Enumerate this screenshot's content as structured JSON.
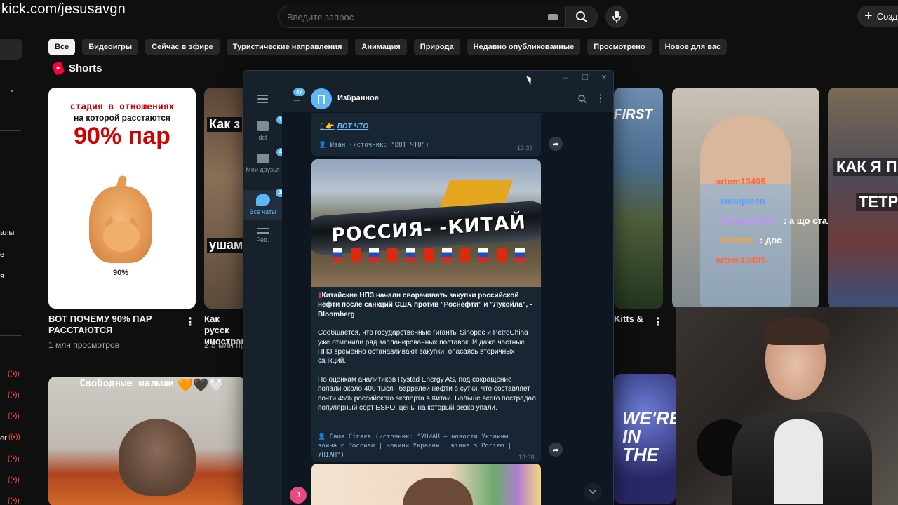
{
  "watermark": "kick.com/jesusavgn",
  "youtube": {
    "search_placeholder": "Введите запрос",
    "create_label": "Созд",
    "chips": [
      "Все",
      "Видеоигры",
      "Сейчас в эфире",
      "Туристические направления",
      "Анимация",
      "Природа",
      "Недавно опубликованные",
      "Просмотрено",
      "Новое для вас"
    ],
    "shorts_label": "Shorts",
    "sidebar_fragments": [
      "алы",
      "е",
      "я",
      "er"
    ],
    "cards": [
      {
        "overlay_line1": "стадия в отношениях",
        "overlay_line2": "на которой расстаются",
        "overlay_big": "90% пар",
        "overlay_small": "90%",
        "title": "ВОТ ПОЧЕМУ 90% ПАР РАССТАЮТСЯ",
        "meta": "1 млн просмотров"
      },
      {
        "overlay_a": "Как з",
        "overlay_b": "ушам",
        "title": "Как русск иностран",
        "meta": "2,5 млн пр"
      },
      {
        "overlay": "FIRST",
        "title": "Kitts &"
      },
      {
        "chat": [
          {
            "name": "artem13495",
            "msg": ""
          },
          {
            "name": "emoqueen",
            "msg": ""
          },
          {
            "name": "Yaroslav753",
            "msg": ": а що сталося"
          },
          {
            "name": "Akihara",
            "msg": ": дос"
          },
          {
            "name": "artem13495",
            "msg": ""
          }
        ]
      },
      {
        "overlay": "КАК Я П",
        "overlay2": "ТЕТР"
      },
      {
        "overlay": "Свободные малыши",
        "hearts": "🧡🖤🤍"
      },
      {
        "overlay": "WE'RE IN THE"
      }
    ]
  },
  "telegram": {
    "back_count": "47",
    "folders": [
      {
        "name": "dct",
        "count": "188"
      },
      {
        "name": "Мои друзья",
        "count": "44"
      },
      {
        "name": "Все чаты",
        "count": "407"
      },
      {
        "name": "Ред."
      }
    ],
    "chat_title": "Избранное",
    "messages": [
      {
        "link_text": "ВОТ ЧТО",
        "fwd": "👤 Иван (источник: \"ВОТ ЧТО\")",
        "time": "13:36"
      },
      {
        "image_text": "РОССИЯ-  -КИТАЙ",
        "headline": "Китайские НПЗ начали сворачивать закупки российской нефти после санкций США против \"Роснефти\" и \"Лукойла\", - Bloomberg",
        "p1": "Сообщается, что государственные гиганты Sinopec и PetroChina уже отменили ряд запланированных поставок. И даже частные НПЗ временно останавливают закупки, опасаясь вторичных санкций.",
        "p2": "По оценкам аналитиков Rystad Energy AS, под сокращение попали около 400 тысяч баррелей нефти в сутки, что составляет почти 45% российского экспорта в Китай. Больше всего пострадал популярный сорт ESPO, цены на который резко упали.",
        "fwd": "👤 Саша Сігаєв (источник: \"УНИАН – новости Украины | война с Россией | новини України | війна з Росією | УНІАН\")",
        "time": "13:38"
      }
    ],
    "user_initial": "J"
  },
  "colors": {
    "tg_accent": "#5eb5f7",
    "yt_bg": "#0f0f0f",
    "tg_bg": "#0e1621"
  }
}
